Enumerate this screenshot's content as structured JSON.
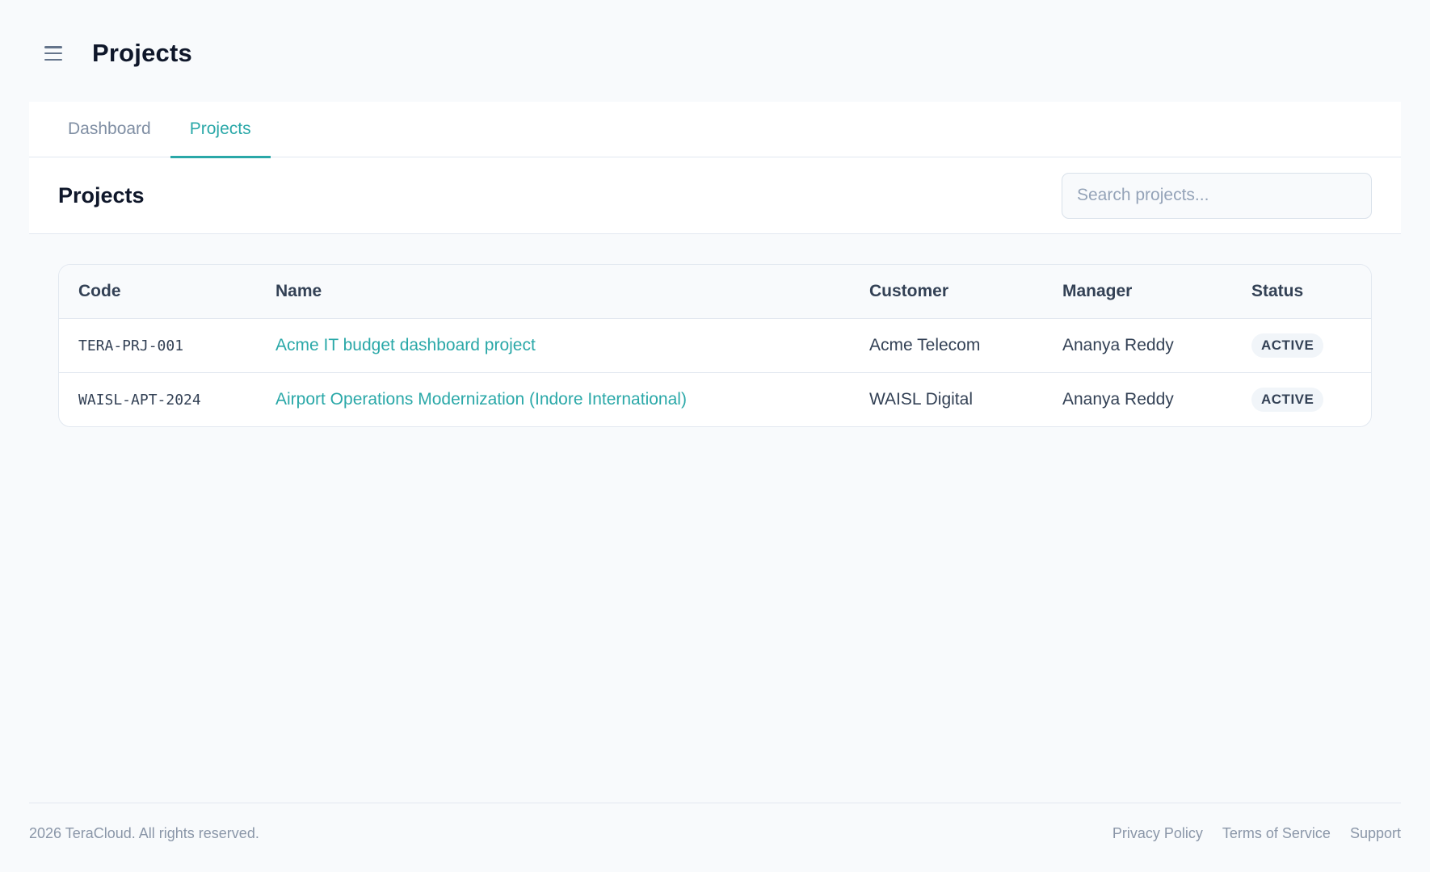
{
  "header": {
    "menu_icon": "hamburger-menu-icon",
    "title": "Projects"
  },
  "tabs": [
    {
      "label": "Dashboard",
      "active": false
    },
    {
      "label": "Projects",
      "active": true
    }
  ],
  "section": {
    "title": "Projects",
    "search_placeholder": "Search projects..."
  },
  "table": {
    "columns": [
      "Code",
      "Name",
      "Customer",
      "Manager",
      "Status"
    ],
    "rows": [
      {
        "code": "TERA-PRJ-001",
        "name": "Acme IT budget dashboard project",
        "customer": "Acme Telecom",
        "manager": "Ananya Reddy",
        "status": "ACTIVE"
      },
      {
        "code": "WAISL-APT-2024",
        "name": "Airport Operations Modernization (Indore International)",
        "customer": "WAISL Digital",
        "manager": "Ananya Reddy",
        "status": "ACTIVE"
      }
    ]
  },
  "footer": {
    "copyright": "2026 TeraCloud. All rights reserved.",
    "links": [
      "Privacy Policy",
      "Terms of Service",
      "Support"
    ]
  },
  "colors": {
    "accent": "#2aa8a8",
    "background": "#f8fafc",
    "border": "#e2e8f0"
  }
}
